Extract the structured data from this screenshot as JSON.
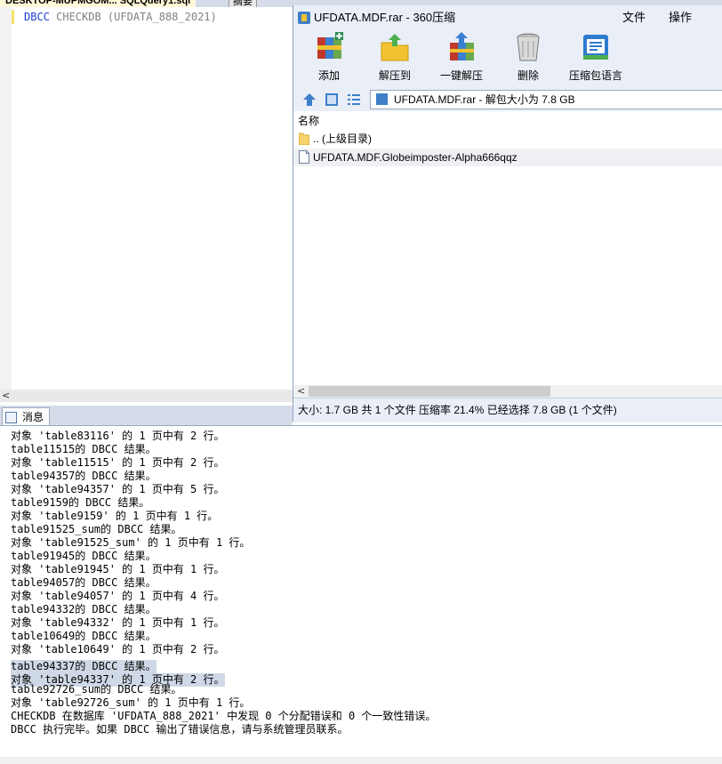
{
  "editor": {
    "tab_label": "DESKTOP-MUPMGOM... SQLQuery1.sql",
    "summary_tab": "摘要",
    "query_keyword": "DBCC",
    "query_rest": " CHECKDB (UFDATA_888_2021)",
    "scroll_left_arrow": "<"
  },
  "archive": {
    "title": "UFDATA.MDF.rar - 360压缩",
    "menu": [
      "文件",
      "操作"
    ],
    "toolbar": [
      {
        "label": "添加",
        "icon": "add-books-icon"
      },
      {
        "label": "解压到",
        "icon": "extract-to-folder-icon"
      },
      {
        "label": "一键解压",
        "icon": "one-click-extract-icon"
      },
      {
        "label": "删除",
        "icon": "trash-bin-icon"
      },
      {
        "label": "压缩包语言",
        "icon": "archive-language-icon"
      }
    ],
    "address": "UFDATA.MDF.rar - 解包大小为 7.8 GB",
    "column_name": "名称",
    "rows": [
      {
        "name": ".. (上级目录)",
        "icon": "folder-icon"
      },
      {
        "name": "UFDATA.MDF.Globeimposter-Alpha666qqz",
        "icon": "file-icon"
      }
    ],
    "scroll_left_arrow": "<",
    "status": "大小: 1.7 GB 共 1 个文件 压缩率 21.4% 已经选择 7.8 GB (1 个文件)",
    "colors": {
      "accent": "#3d7fc8",
      "folder": "#f5d26b"
    }
  },
  "messages": {
    "tab_label": "消息",
    "lines": [
      {
        "text": "对象 'table83116' 的 1 页中有 2 行。",
        "hl": false
      },
      {
        "text": "table11515的 DBCC 结果。",
        "hl": false
      },
      {
        "text": "对象 'table11515' 的 1 页中有 2 行。",
        "hl": false
      },
      {
        "text": "table94357的 DBCC 结果。",
        "hl": false
      },
      {
        "text": "对象 'table94357' 的 1 页中有 5 行。",
        "hl": false
      },
      {
        "text": "table9159的 DBCC 结果。",
        "hl": false
      },
      {
        "text": "对象 'table9159' 的 1 页中有 1 行。",
        "hl": false
      },
      {
        "text": "table91525_sum的 DBCC 结果。",
        "hl": false
      },
      {
        "text": "对象 'table91525_sum' 的 1 页中有 1 行。",
        "hl": false
      },
      {
        "text": "table91945的 DBCC 结果。",
        "hl": false
      },
      {
        "text": "对象 'table91945' 的 1 页中有 1 行。",
        "hl": false
      },
      {
        "text": "table94057的 DBCC 结果。",
        "hl": false
      },
      {
        "text": "对象 'table94057' 的 1 页中有 4 行。",
        "hl": false
      },
      {
        "text": "table94332的 DBCC 结果。",
        "hl": false
      },
      {
        "text": "对象 'table94332' 的 1 页中有 1 行。",
        "hl": false
      },
      {
        "text": "table10649的 DBCC 结果。",
        "hl": false
      },
      {
        "text": "对象 'table10649' 的 1 页中有 2 行。",
        "hl": false
      },
      {
        "text": "table94337的 DBCC 结果。",
        "hl": true
      },
      {
        "text": "对象 'table94337' 的 1 页中有 2 行。",
        "hl": true
      },
      {
        "text": "table92726_sum的 DBCC 结果。",
        "hl": false
      },
      {
        "text": "对象 'table92726_sum' 的 1 页中有 1 行。",
        "hl": false
      },
      {
        "text": "CHECKDB 在数据库 'UFDATA_888_2021' 中发现 0 个分配错误和 0 个一致性错误。",
        "hl": false
      },
      {
        "text": "DBCC 执行完毕。如果 DBCC 输出了错误信息，请与系统管理员联系。",
        "hl": false
      }
    ]
  }
}
